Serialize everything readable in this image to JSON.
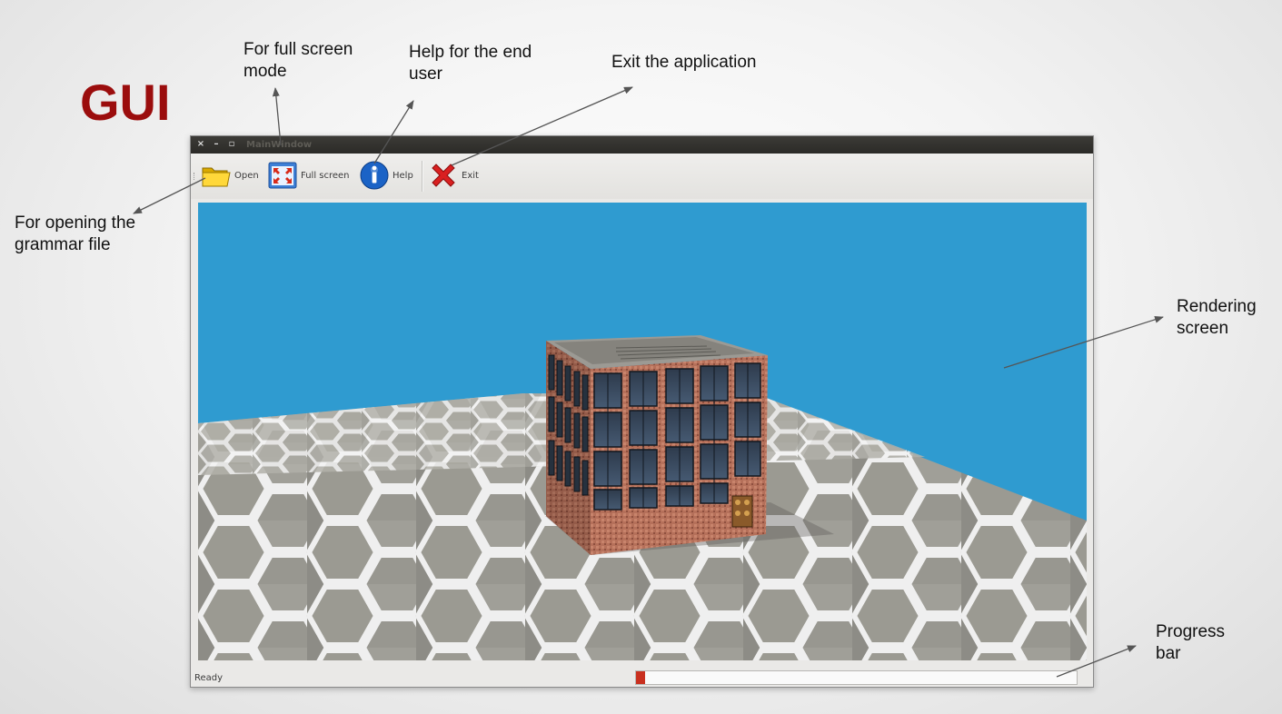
{
  "slide": {
    "title": "GUI",
    "callouts": {
      "full_screen": "For full screen\nmode",
      "help": "Help for the end\nuser",
      "exit": "Exit the application",
      "open": "For opening the\ngrammar file",
      "rendering": "Rendering\nscreen",
      "progress": "Progress\nbar"
    },
    "colors": {
      "title": "#9b0d0d",
      "sky": "#2f9bd0"
    }
  },
  "window": {
    "title": "MainWindow",
    "controls": {
      "close": "×",
      "minimize": "–",
      "maximize": "▫"
    },
    "toolbar": [
      {
        "label": "Open",
        "icon": "folder-open-icon"
      },
      {
        "label": "Full screen",
        "icon": "fullscreen-icon"
      },
      {
        "label": "Help",
        "icon": "info-icon"
      },
      {
        "label": "Exit",
        "icon": "exit-x-icon"
      }
    ],
    "status": {
      "text": "Ready",
      "progress": 0.005
    }
  }
}
